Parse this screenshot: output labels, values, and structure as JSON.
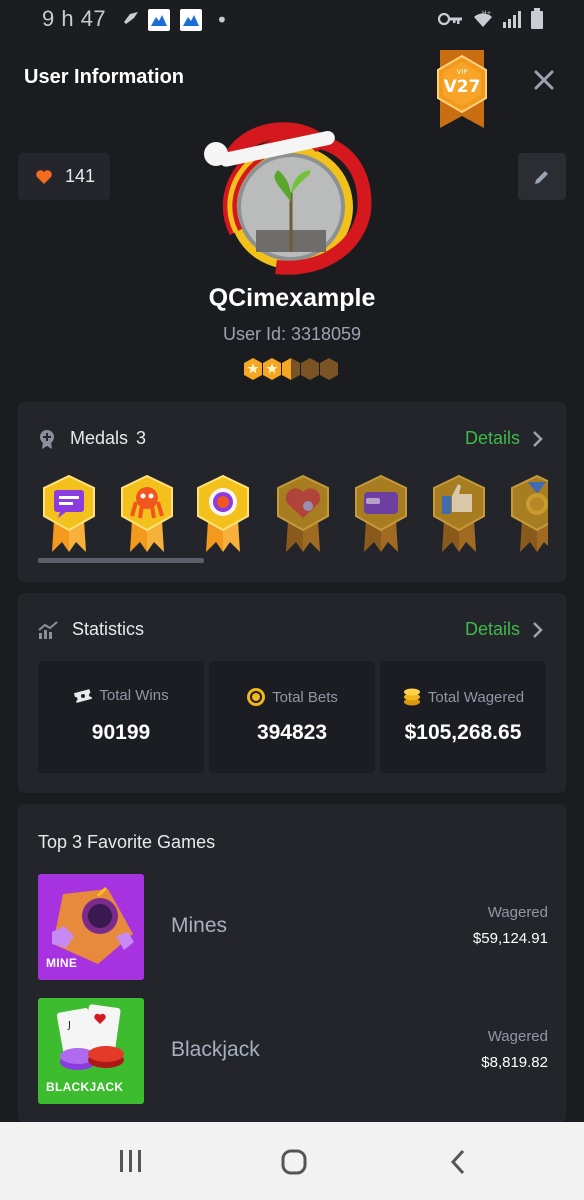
{
  "status_bar": {
    "time": "9 h 47",
    "dot": "•",
    "icons": [
      "bird-icon",
      "app-icon",
      "app-icon",
      "key-icon",
      "wifi-icon",
      "signal-icon",
      "battery-icon"
    ]
  },
  "header": {
    "title": "User Information",
    "vip_level": "V27",
    "vip_small": "VIP"
  },
  "profile": {
    "likes": "141",
    "username": "QCimexample",
    "user_id": "User Id: 3318059",
    "level_stars_filled": 2.5,
    "level_stars_total": 5
  },
  "medals": {
    "label": "Medals",
    "count": "3",
    "details_label": "Details",
    "items": [
      "chat-medal",
      "octopus-medal",
      "target-medal",
      "heart-medal",
      "wallet-medal",
      "thumbs-up-medal",
      "ribbon-medal"
    ]
  },
  "statistics": {
    "label": "Statistics",
    "details_label": "Details",
    "items": [
      {
        "label": "Total Wins",
        "value": "90199",
        "icon": "ticket-icon"
      },
      {
        "label": "Total Bets",
        "value": "394823",
        "icon": "chip-icon"
      },
      {
        "label": "Total Wagered",
        "value": "$105,268.65",
        "icon": "coins-icon"
      }
    ]
  },
  "favorite_games": {
    "title": "Top 3 Favorite Games",
    "items": [
      {
        "name": "Mines",
        "thumb_text": "MINE",
        "wager_label": "Wagered",
        "wager_value": "$59,124.91"
      },
      {
        "name": "Blackjack",
        "thumb_text": "BLACKJACK",
        "wager_label": "Wagered",
        "wager_value": "$8,819.82"
      }
    ]
  },
  "colors": {
    "accent_green": "#3fb94a",
    "heart_orange": "#f46a1f",
    "background": "#1a1c20",
    "card": "#23252b"
  }
}
